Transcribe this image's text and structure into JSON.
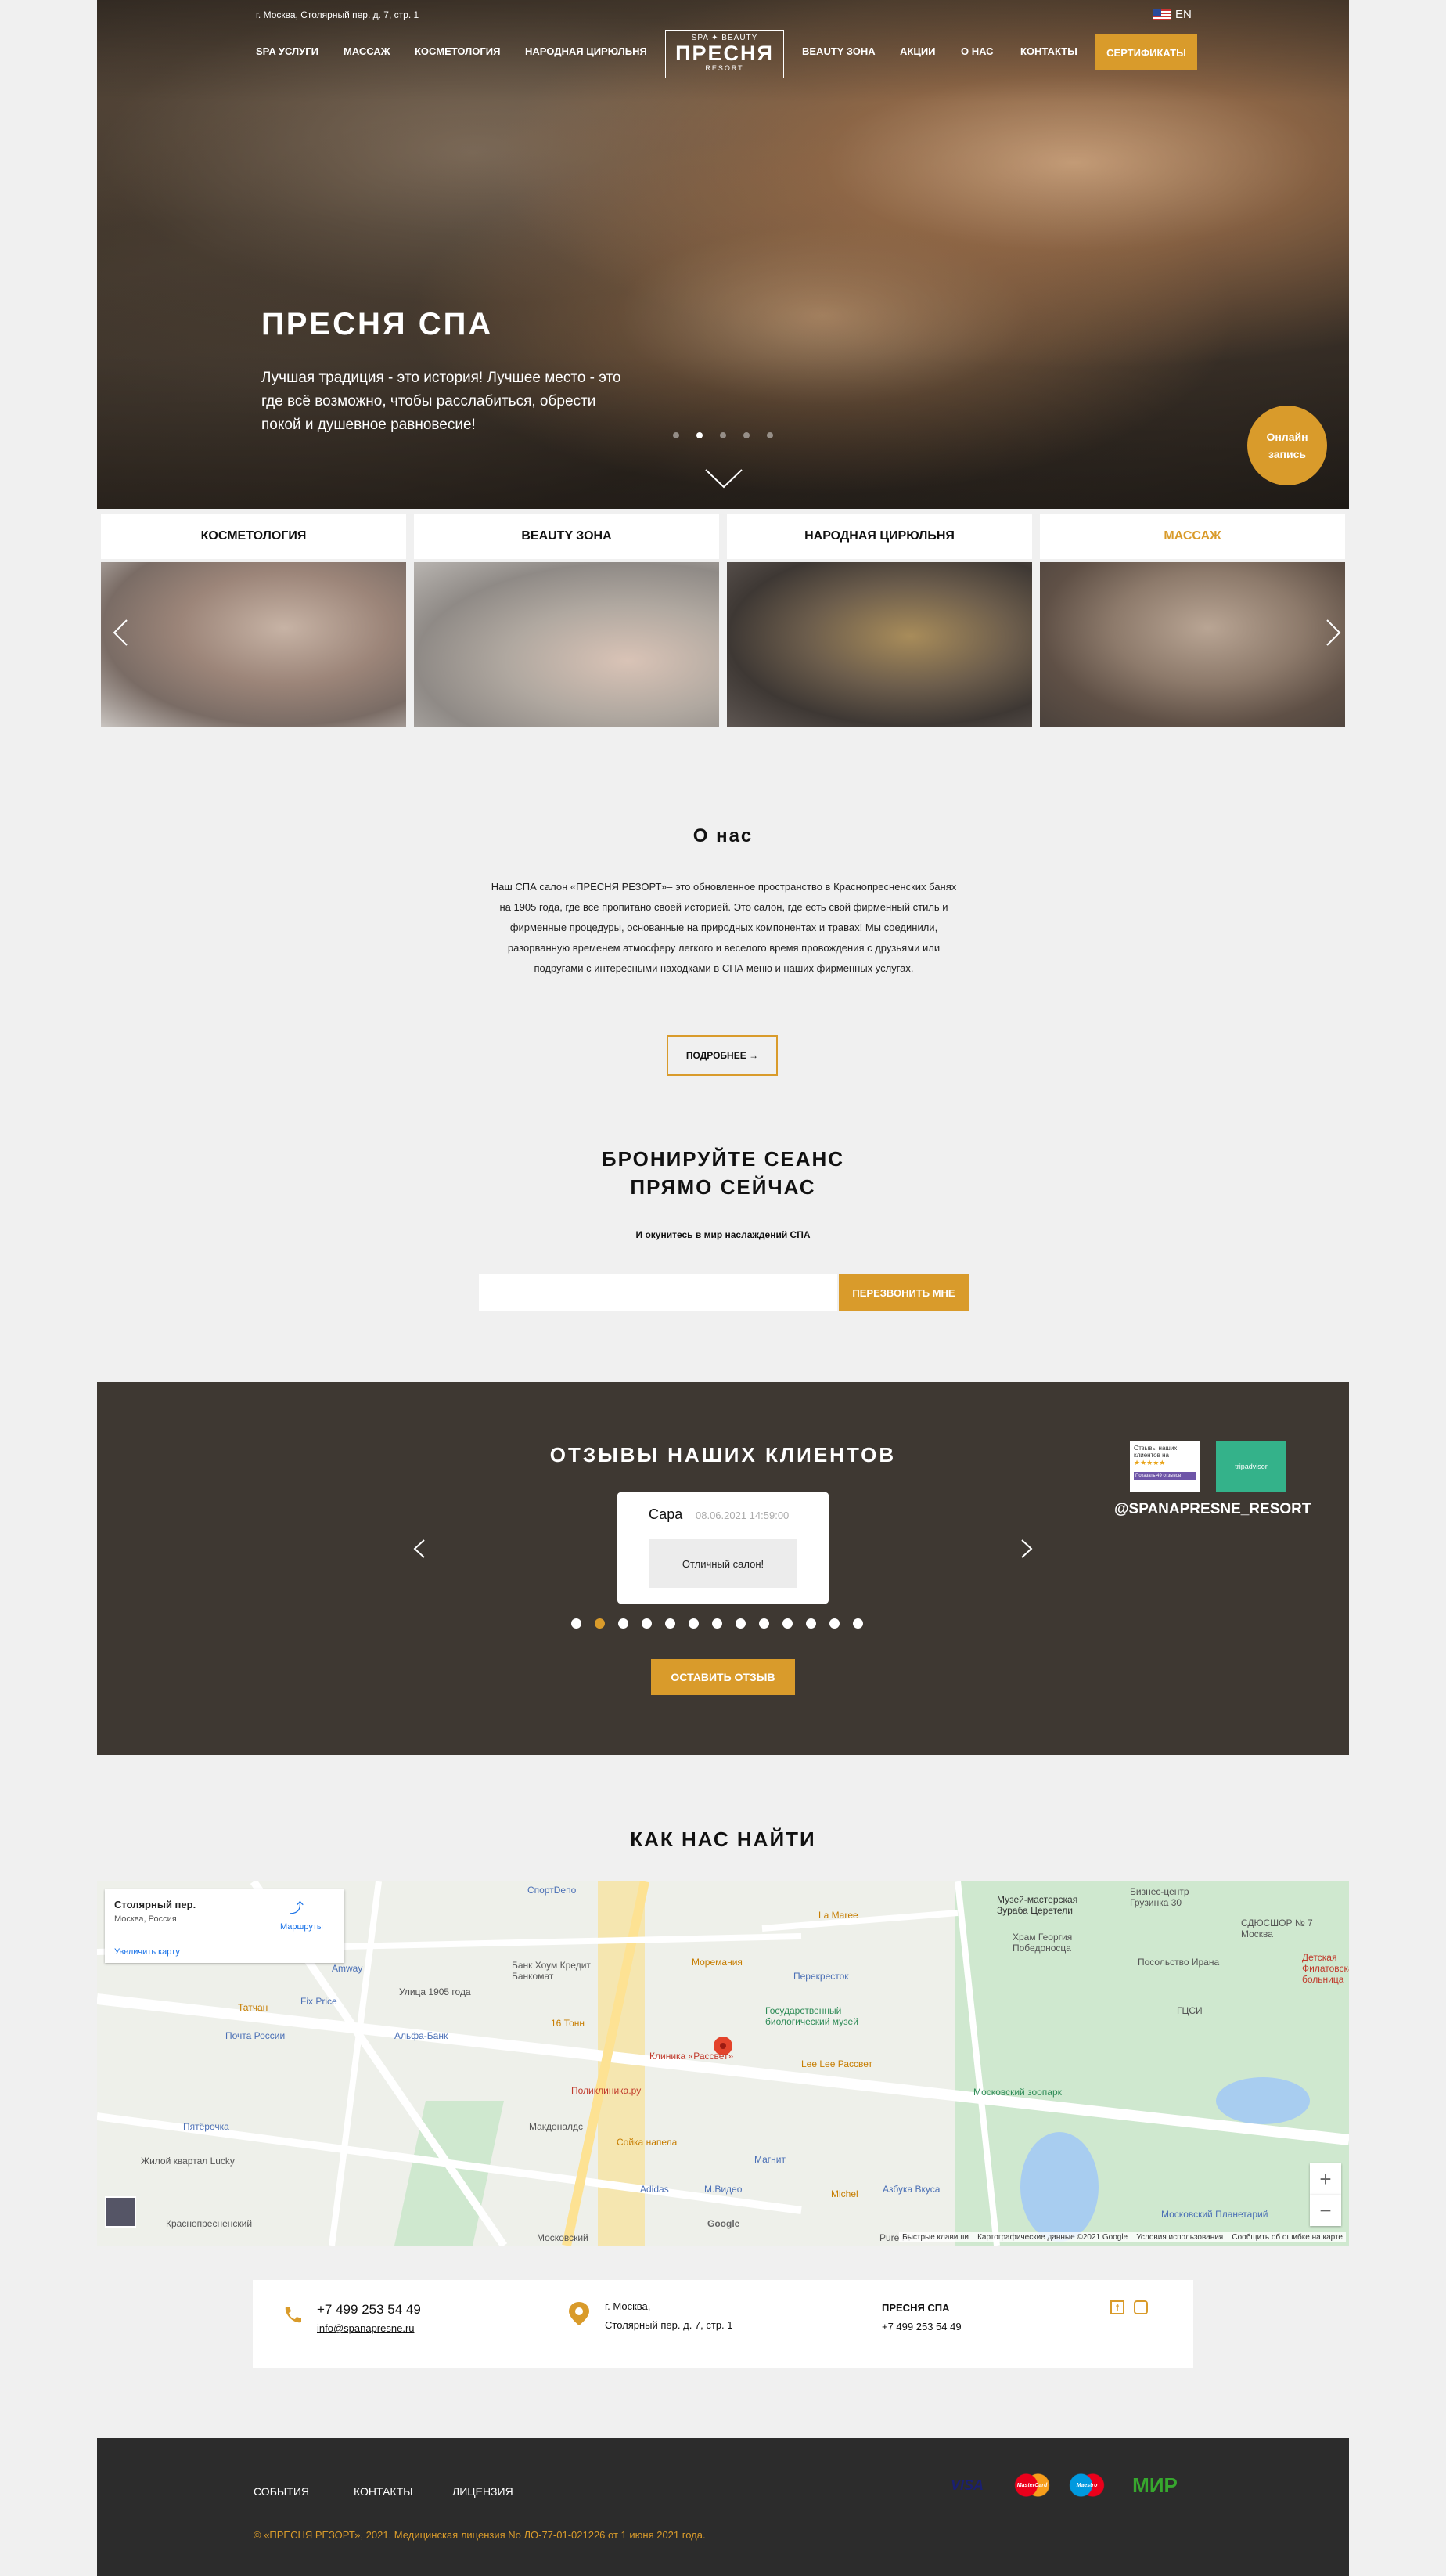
{
  "header": {
    "address": "г. Москва, Столярный пер. д. 7, стр. 1",
    "lang": "EN",
    "nav_left": [
      "SPA УСЛУГИ",
      "МАССАЖ",
      "КОСМЕТОЛОГИЯ",
      "НАРОДНАЯ ЦИРЮЛЬНЯ"
    ],
    "nav_right": [
      "BEAUTY ЗОНА",
      "АКЦИИ",
      "О НАС",
      "КОНТАКТЫ"
    ],
    "cert_button": "СЕРТИФИКАТЫ",
    "logo": {
      "top": "SPA ✦ BEAUTY",
      "name": "ПРЕСНЯ",
      "bottom": "RESORT"
    }
  },
  "hero": {
    "title": "ПРЕСНЯ СПА",
    "subtitle": "Лучшая традиция - это история! Лучшее место - это где всё возможно, чтобы расслабиться, обрести покой и душевное равновесие!",
    "online_button": "Онлайн запись",
    "slides": 5,
    "active_slide": 2
  },
  "categories": [
    {
      "label": "КОСМЕТОЛОГИЯ",
      "active": false
    },
    {
      "label": "BEAUTY ЗОНА",
      "active": false
    },
    {
      "label": "НАРОДНАЯ ЦИРЮЛЬНЯ",
      "active": false
    },
    {
      "label": "МАССАЖ",
      "active": true
    }
  ],
  "about": {
    "title": "О нас",
    "text": "Наш СПА салон «ПРЕСНЯ РЕЗОРТ»– это обновленное пространство в Краснопресненских банях на 1905 года, где все пропитано своей историей. Это салон, где есть свой фирменный стиль и фирменные процедуры, основанные на природных компонентах и травах! Мы соединили, разорванную временем атмосферу легкого и веселого время провождения с друзьями или подругами с интересными находками в СПА меню и наших фирменных услугах.",
    "more_button": "ПОДРОБНЕЕ →"
  },
  "booking": {
    "title_line1": "БРОНИРУЙТЕ СЕАНС",
    "title_line2": "ПРЯМО СЕЙЧАС",
    "subtitle": "И окунитесь в мир наслаждений СПА",
    "input_value": "",
    "button": "ПЕРЕЗВОНИТЬ МНЕ"
  },
  "reviews": {
    "title": "ОТЗЫВЫ НАШИХ КЛИЕНТОВ",
    "name": "Сара",
    "date": "08.06.2021 14:59:00",
    "message": "Отличный салон!",
    "dots": 13,
    "active_dot": 1,
    "button": "ОСТАВИТЬ ОТЗЫВ",
    "instagram": "@SPANAPRESNE_RESORT",
    "badge1_text": "Отзывы наших клиентов на",
    "badge1_bar": "Показать 49 отзывов",
    "badge2_text": "tripadvisor"
  },
  "map": {
    "title": "КАК НАС НАЙТИ",
    "place_name": "Столярный пер.",
    "place_region": "Москва, Россия",
    "routes": "Маршруты",
    "enlarge": "Увеличить карту",
    "labels": [
      "СпортDепо",
      "La Maree",
      "Музей-мастерская Зураба Церетели",
      "Бизнес-центр Грузинка 30",
      "СДЮСШОР № 7 Москва",
      "Храм Георгия Победоносца",
      "Моремания",
      "Банк Хоум Кредит Банкомат",
      "Перекресток",
      "Детская Филатовская больница",
      "Посольство Ирана",
      "Улица 1905 года",
      "Amway",
      "Fix Price",
      "Татчан",
      "16 Тонн",
      "Государственный биологический музей",
      "ГЦСИ",
      "Почта России",
      "Альфа-Банк",
      "Клиника «Рассвет»",
      "Lee Lee Рассвет",
      "Поликлиника.ру",
      "Московский зоопарк",
      "Пятёрочка",
      "Макдоналдс",
      "Сойка напела",
      "Магнит",
      "Жилой квартал Lucky",
      "Adidas",
      "М.Видео",
      "Michel",
      "Азбука Вкуса",
      "Краснопресненский",
      "Московский",
      "Московский Планетарий",
      "Pure Pl"
    ],
    "attribution": [
      "Быстрые клавиши",
      "Картографические данные ©2021 Google",
      "Условия использования",
      "Сообщить об ошибке на карте"
    ],
    "google": "Google"
  },
  "contacts": {
    "phone": "+7 499 253 54 49",
    "email": "info@spanapresne.ru",
    "addr_line1": "г. Москва,",
    "addr_line2": "Столярный пер. д. 7, стр. 1",
    "brand": "ПРЕСНЯ СПА",
    "brand_phone": "+7 499 253 54 49"
  },
  "footer": {
    "links": [
      "СОБЫТИЯ",
      "КОНТАКТЫ",
      "ЛИЦЕНЗИЯ"
    ],
    "copyright": "© «ПРЕСНЯ РЕЗОРТ», 2021. Медицинская лицензия No ЛО-77-01-021226 от 1 июня 2021 года.",
    "payments": [
      "VISA",
      "MasterCard",
      "Maestro",
      "МИР"
    ]
  },
  "colors": {
    "accent": "#d99b2b",
    "dark": "#3e3832",
    "footer": "#2c2c2c"
  }
}
